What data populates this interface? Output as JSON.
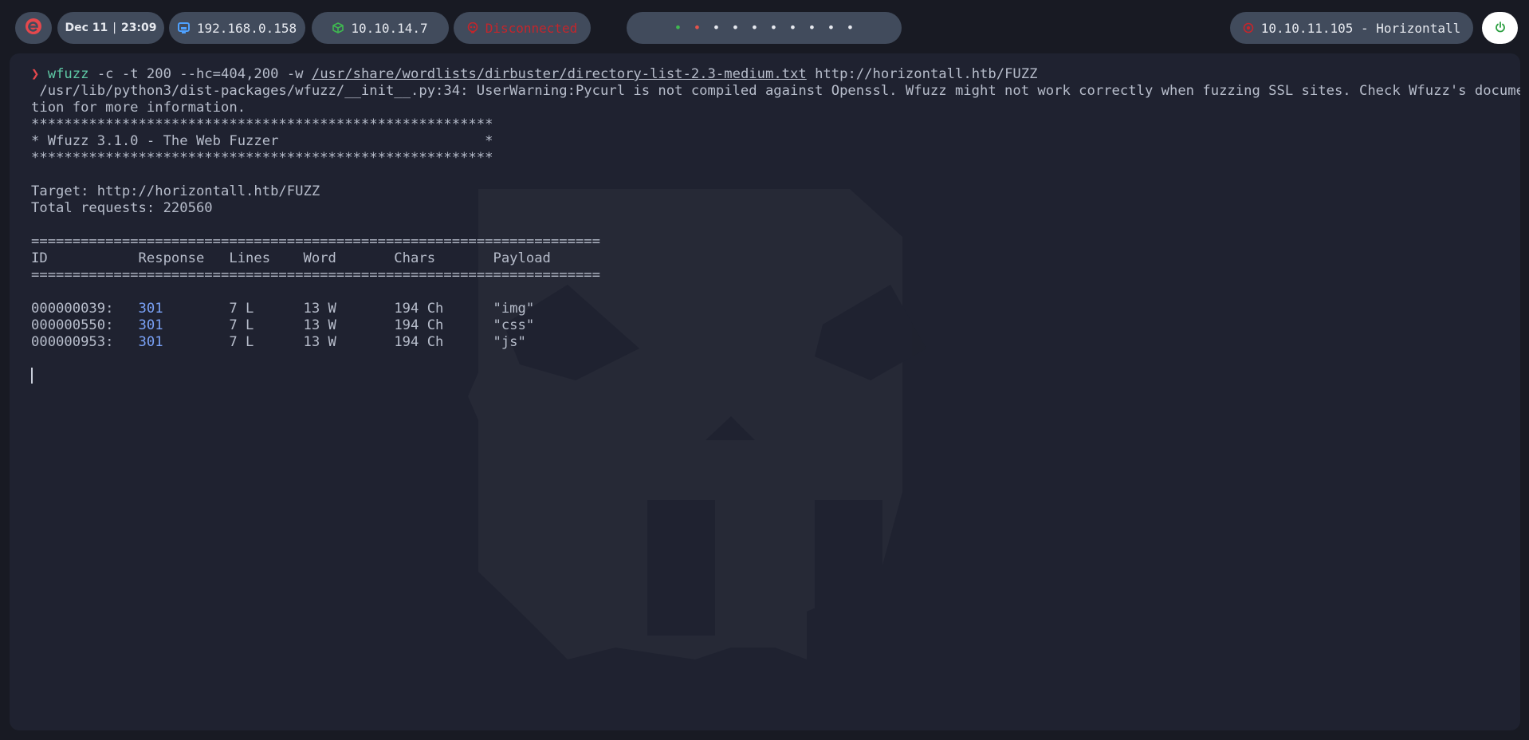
{
  "topbar": {
    "logo_icon": "e-logo-icon",
    "date": "Dec 11",
    "time": "23:09",
    "lan_ip": "192.168.0.158",
    "lan_icon": "network-icon",
    "vpn_ip": "10.10.14.7",
    "vpn_icon": "cube-icon",
    "status": "Disconnected",
    "status_icon": "skull-icon",
    "target": "10.10.11.105 - Horizontall",
    "target_icon": "target-icon",
    "power_icon": "power-icon",
    "workspaces": [
      {
        "glyph": "•",
        "state": "active"
      },
      {
        "glyph": "•",
        "state": "urgent"
      },
      {
        "glyph": "•",
        "state": "normal"
      },
      {
        "glyph": "•",
        "state": "normal"
      },
      {
        "glyph": "•",
        "state": "normal"
      },
      {
        "glyph": "•",
        "state": "normal"
      },
      {
        "glyph": "•",
        "state": "normal"
      },
      {
        "glyph": "•",
        "state": "normal"
      },
      {
        "glyph": "•",
        "state": "normal"
      },
      {
        "glyph": "•",
        "state": "normal"
      }
    ]
  },
  "terminal": {
    "prompt": "❯",
    "command": "wfuzz",
    "args1": " -c -t 200 --hc=404,200 -w ",
    "wordlist": "/usr/share/wordlists/dirbuster/directory-list-2.3-medium.txt",
    "url": " http://horizontall.htb/FUZZ",
    "warning1": " /usr/lib/python3/dist-packages/wfuzz/__init__.py:34: UserWarning:Pycurl is not compiled against Openssl. Wfuzz might not work correctly when fuzzing SSL sites. Check Wfuzz's documenta",
    "warning2": "tion for more information.",
    "stars": "********************************************************",
    "banner": "* Wfuzz 3.1.0 - The Web Fuzzer                         *",
    "target_line": "Target: http://horizontall.htb/FUZZ",
    "total_line": "Total requests: 220560",
    "separator": "=====================================================================",
    "header": "ID           Response   Lines    Word       Chars       Payload",
    "results": [
      {
        "id": "000000039:",
        "code": "301",
        "rest": "        7 L      13 W       194 Ch      \"img\""
      },
      {
        "id": "000000550:",
        "code": "301",
        "rest": "        7 L      13 W       194 Ch      \"css\""
      },
      {
        "id": "000000953:",
        "code": "301",
        "rest": "        7 L      13 W       194 Ch      \"js\""
      }
    ]
  },
  "colors": {
    "background": "#181a23",
    "terminal_bg": "#1f2230",
    "pill_bg": "#414b5c",
    "accent_red": "#e5484d",
    "accent_green": "#5ec9a5",
    "code_blue": "#7aa2f7"
  }
}
